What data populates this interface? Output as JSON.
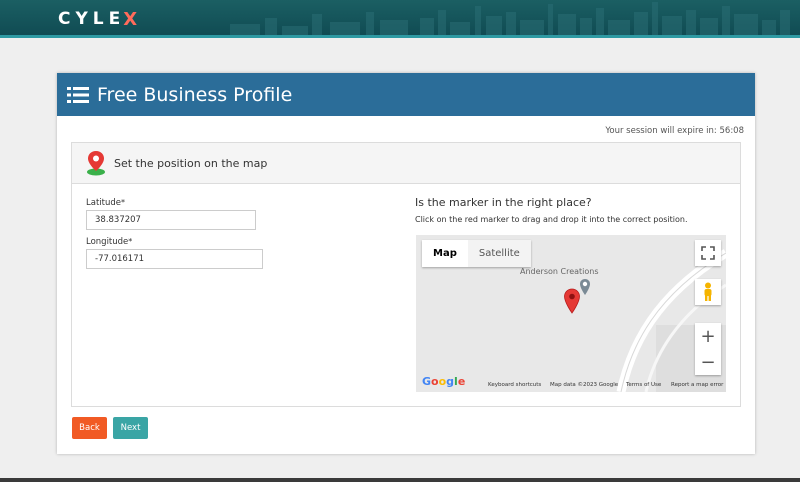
{
  "site": {
    "logo_text": "CYLE",
    "logo_x": "X"
  },
  "header": {
    "title": "Free Business Profile"
  },
  "session": {
    "text": "Your session will expire in: 56:08"
  },
  "panel": {
    "title": "Set the position on the map"
  },
  "form": {
    "latitude_label": "Latitude",
    "latitude_value": "38.837207",
    "longitude_label": "Longitude",
    "longitude_value": "-77.016171",
    "required_mark": "*"
  },
  "map_section": {
    "question": "Is the marker in the right place?",
    "instruction": "Click on the red marker to drag and drop it into the correct position."
  },
  "map": {
    "tab_map": "Map",
    "tab_satellite": "Satellite",
    "place_label": "Anderson Creations",
    "google_letters": [
      "G",
      "o",
      "o",
      "g",
      "l",
      "e"
    ],
    "zoom_in": "+",
    "zoom_out": "−",
    "footer": {
      "shortcuts": "Keyboard shortcuts",
      "map_data": "Map data ©2023 Google",
      "terms": "Terms of Use",
      "report": "Report a map error"
    },
    "colors": {
      "marker": "#e53935",
      "poi_marker": "#7a8a95"
    }
  },
  "buttons": {
    "back": "Back",
    "next": "Next"
  },
  "colors": {
    "header_bg": "#2b6d99",
    "topbar_bg": "#0f4a52",
    "back_btn": "#f15a24",
    "next_btn": "#3aa5a5"
  }
}
